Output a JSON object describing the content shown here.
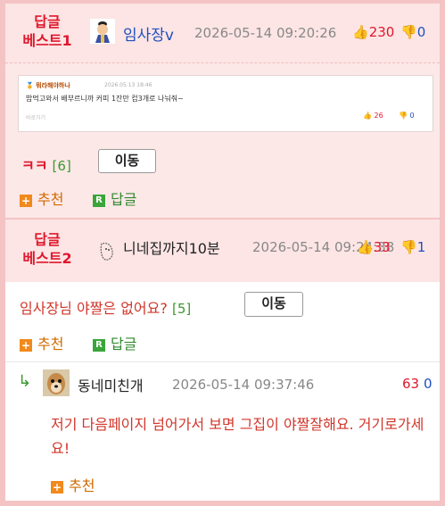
{
  "best1": {
    "badge_line1": "답글",
    "badge_line2": "베스트1",
    "nickname": "임사장v",
    "date": "2026-05-14 09:20:26",
    "up_count": "230",
    "down_count": "0",
    "quote": {
      "user": "🏅 뭐라해야하나",
      "date": "2026.05.13 18:46",
      "text": "밥먹고와서 배부르니까 커피 1잔만 컵3개로 나눠줘~",
      "goto": "바로가기",
      "up": "26",
      "down": "0"
    },
    "content": "ㅋㅋ",
    "reply_count": "[6]",
    "move_label": "이동",
    "recommend_label": "추천",
    "reply_label": "답글"
  },
  "best2": {
    "badge_line1": "답글",
    "badge_line2": "베스트2",
    "nickname": "니네집까지10분",
    "date": "2026-05-14 09:24:38",
    "up_count": "33",
    "down_count": "1",
    "content": "임사장님 야짤은 없어요?",
    "reply_count": "[5]",
    "move_label": "이동",
    "recommend_label": "추천",
    "reply_label": "답글"
  },
  "reply": {
    "nickname": "동네미친개",
    "date": "2026-05-14 09:37:46",
    "up_count": "63",
    "down_count": "0",
    "text": "저기 다음페이지 넘어가서 보면 그집이 야짤잘해요. 거기로가세요!",
    "recommend_label": "추천"
  },
  "colors": {
    "badge_red": "#e0172c",
    "nick_blue": "#1f4fbf",
    "best_bg": "#fde8e8",
    "frame_pink": "#f4c4c4"
  }
}
